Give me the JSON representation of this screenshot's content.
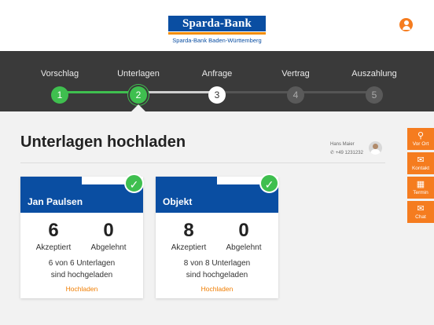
{
  "brand": {
    "name": "Sparda-Bank",
    "subtitle": "Sparda-Bank Baden-Württemberg",
    "color": "#0a4ea2",
    "accent": "#f28c00"
  },
  "header": {
    "user_icon": "user-icon"
  },
  "steps": [
    {
      "number": "1",
      "label": "Vorschlag",
      "state": "done"
    },
    {
      "number": "2",
      "label": "Unterlagen",
      "state": "active"
    },
    {
      "number": "3",
      "label": "Anfrage",
      "state": "current"
    },
    {
      "number": "4",
      "label": "Vertrag",
      "state": "todo"
    },
    {
      "number": "5",
      "label": "Auszahlung",
      "state": "todo"
    }
  ],
  "main": {
    "title": "Unterlagen hochladen",
    "contact": {
      "name": "Hans Maier",
      "phone": "+49 1231232"
    }
  },
  "cards": [
    {
      "title": "Jan Paulsen",
      "accepted_value": "6",
      "accepted_label": "Akzeptiert",
      "rejected_value": "0",
      "rejected_label": "Abgelehnt",
      "info_line1": "6 von 6 Unterlagen",
      "info_line2": "sind hochgeladen",
      "link": "Hochladen"
    },
    {
      "title": "Objekt",
      "accepted_value": "8",
      "accepted_label": "Akzeptiert",
      "rejected_value": "0",
      "rejected_label": "Abgelehnt",
      "info_line1": "8 von 8 Unterlagen",
      "info_line2": "sind hochgeladen",
      "link": "Hochladen"
    }
  ],
  "sidebar": [
    {
      "label": "Vor Ort",
      "icon": "location-pin-icon"
    },
    {
      "label": "Kontakt",
      "icon": "envelope-icon"
    },
    {
      "label": "Termin",
      "icon": "calendar-icon"
    },
    {
      "label": "Chat",
      "icon": "chat-icon"
    }
  ]
}
